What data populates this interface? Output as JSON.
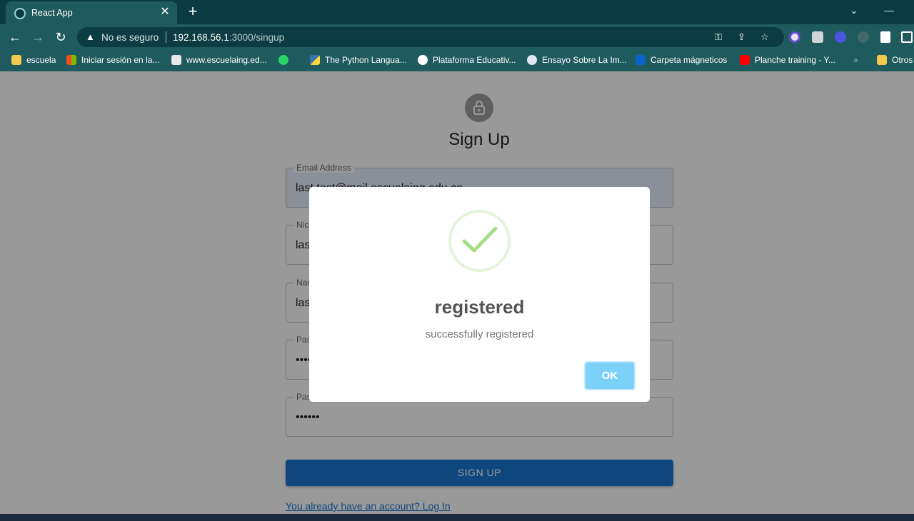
{
  "browser": {
    "tab_title": "React App",
    "tab_close": "✕",
    "new_tab": "+",
    "back": "←",
    "forward": "→",
    "reload": "↻",
    "security_text": "No es seguro",
    "url_host": "192.168.56.1",
    "url_rest": ":3000/singup"
  },
  "bookmarks": [
    {
      "label": "escuela",
      "icon": "folder-icon",
      "color": "#f2c94c"
    },
    {
      "label": "Iniciar sesión en la...",
      "icon": "microsoft-icon",
      "color": "#f25022"
    },
    {
      "label": "www.escuelaing.ed...",
      "icon": "page-icon",
      "color": "#e8e8e8"
    },
    {
      "label": "",
      "icon": "whatsapp-icon",
      "color": "#25d366"
    },
    {
      "label": "The Python Langua...",
      "icon": "python-icon",
      "color": "#3776ab"
    },
    {
      "label": "Plataforma Educativ...",
      "icon": "globe-icon",
      "color": "#ffffff"
    },
    {
      "label": "Ensayo Sobre La Im...",
      "icon": "site-icon",
      "color": "#dfe7ef"
    },
    {
      "label": "Carpeta mágneticos",
      "icon": "outlook-icon",
      "color": "#0a64c8"
    },
    {
      "label": "Planche training - Y...",
      "icon": "youtube-icon",
      "color": "#ff0000"
    },
    {
      "label": "»",
      "icon": "more-icon",
      "color": ""
    },
    {
      "label": "Otros",
      "icon": "folder-icon",
      "color": "#f2c94c"
    }
  ],
  "page": {
    "heading": "Sign Up",
    "fields": [
      {
        "label": "Email Address",
        "value": "last.test@mail.escuelaing.edu.co",
        "filled": true
      },
      {
        "label": "Nickname",
        "value": "last",
        "filled": false
      },
      {
        "label": "Name",
        "value": "last",
        "filled": false
      },
      {
        "label": "Password",
        "value": "••••••",
        "filled": false
      },
      {
        "label": "Password",
        "value": "••••••",
        "filled": false
      }
    ],
    "signup_label": "SIGN UP",
    "login_link": "You already have an account? Log In"
  },
  "modal": {
    "title": "registered",
    "text": "successfully registered",
    "ok_label": "OK"
  },
  "colors": {
    "accent": "#1976d2",
    "success": "#a5dc86",
    "ok_button": "#7cd1f9"
  }
}
